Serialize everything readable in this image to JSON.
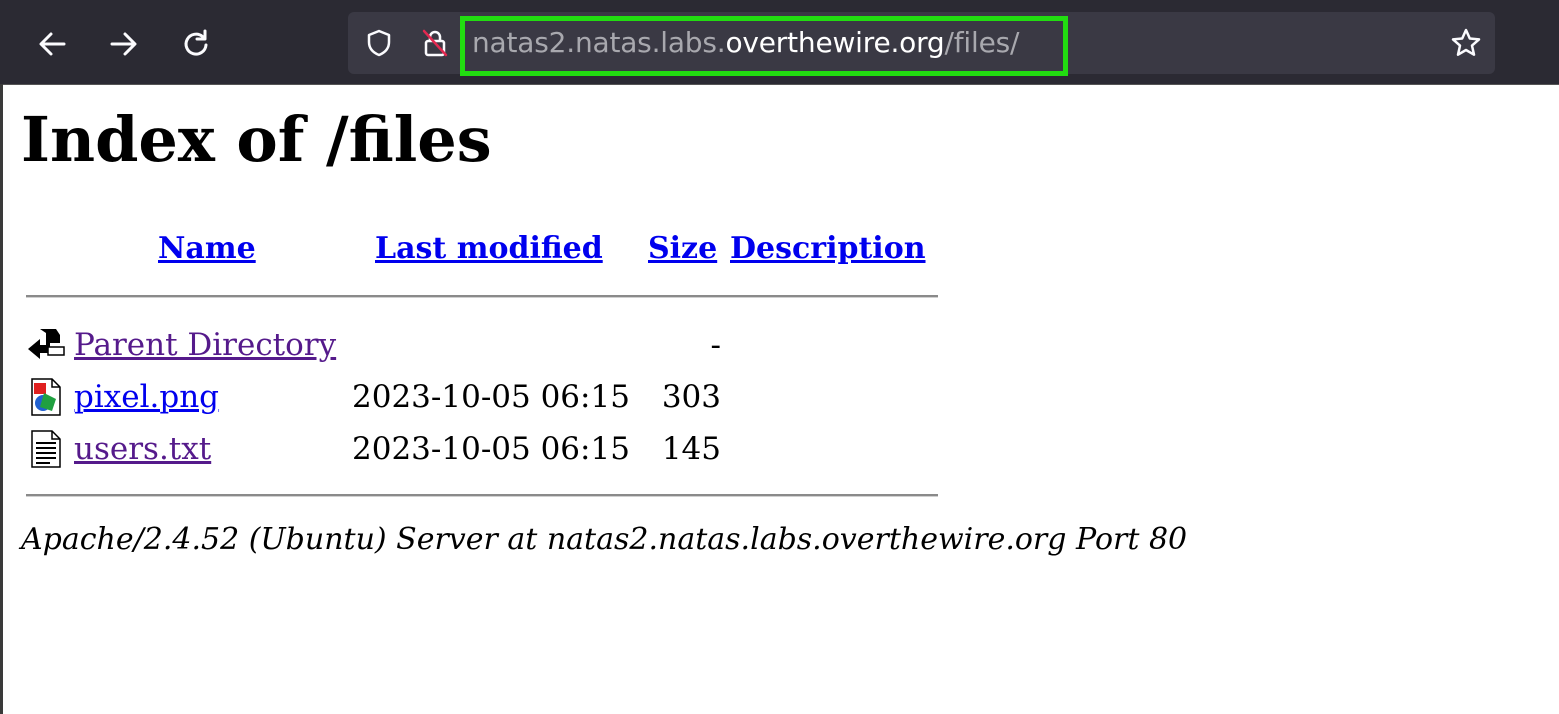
{
  "browser": {
    "url_prefix": "natas2.natas.labs.",
    "url_domain": "overthewire.org",
    "url_path": "/files/",
    "highlight_color": "#22dd11",
    "icons": [
      "back-arrow-icon",
      "forward-arrow-icon",
      "reload-icon",
      "shield-icon",
      "insecure-lock-icon",
      "bookmark-star-icon"
    ]
  },
  "page": {
    "title": "Index of /files",
    "columns": {
      "name": "Name",
      "last_modified": "Last modified",
      "size": "Size",
      "description": "Description"
    },
    "rows": [
      {
        "icon": "back-folder-icon",
        "name": "Parent Directory",
        "date": "",
        "size": "-",
        "visited": true
      },
      {
        "icon": "image-file-icon",
        "name": "pixel.png",
        "date": "2023-10-05 06:15",
        "size": "303",
        "visited": false
      },
      {
        "icon": "text-file-icon",
        "name": "users.txt",
        "date": "2023-10-05 06:15",
        "size": "145",
        "visited": true
      }
    ],
    "footer": "Apache/2.4.52 (Ubuntu) Server at natas2.natas.labs.overthewire.org Port 80"
  }
}
